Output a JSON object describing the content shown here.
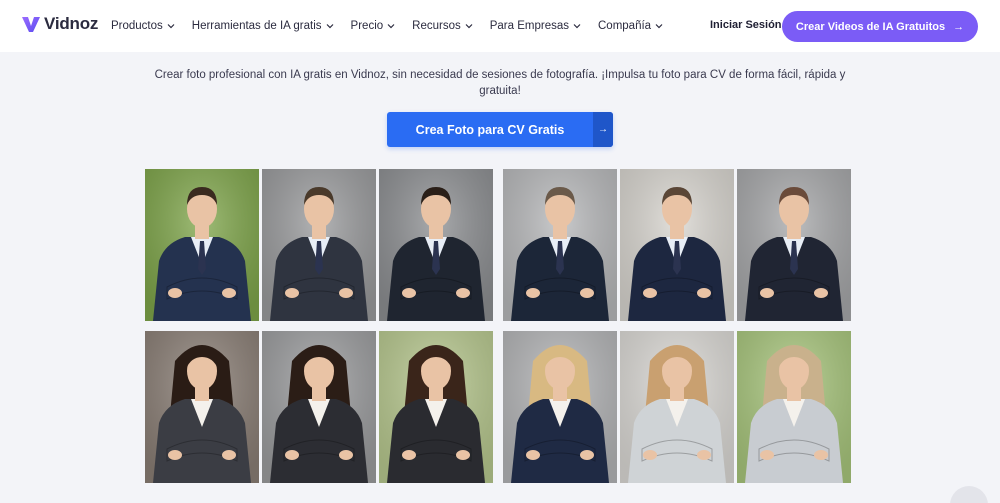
{
  "brand": {
    "name": "Vidnoz",
    "accent": "#7b5cf6",
    "primary_blue": "#2a6cf3"
  },
  "nav": {
    "items": [
      {
        "label": "Productos"
      },
      {
        "label": "Herramientas de IA gratis"
      },
      {
        "label": "Precio"
      },
      {
        "label": "Recursos"
      },
      {
        "label": "Para Empresas"
      },
      {
        "label": "Compañía"
      }
    ],
    "login_label": "Iniciar Sesión",
    "cta_label": "Crear Videos de IA Gratuitos"
  },
  "hero": {
    "subtitle": "Crear foto profesional con IA gratis en Vidnoz, sin necesidad de sesiones de fotografía. ¡Impulsa tu foto para CV de forma fácil, rápida y gratuita!",
    "cta_label": "Crea Foto para CV Gratis",
    "cta_icon": "arrow-right-icon"
  },
  "gallery": {
    "rows": [
      [
        {
          "name": "man-green-bg-crossed-arms",
          "bg": "#7fa64a"
        },
        {
          "name": "man-grey-bg-glasses",
          "bg": "#9a9b9d"
        },
        {
          "name": "man-office-bg-crossed-arms",
          "bg": "#8d8f92"
        },
        {
          "name": "man-grey-bg-smiling",
          "bg": "#b8b9bb"
        },
        {
          "name": "man-office-window-bg",
          "bg": "#d9d6d0"
        },
        {
          "name": "man-grey-bg-closeup",
          "bg": "#a7a8aa"
        }
      ],
      [
        {
          "name": "woman-office-bg-glasses",
          "bg": "#8b7f76"
        },
        {
          "name": "woman-grey-bg-dark-hair",
          "bg": "#9c9d9f"
        },
        {
          "name": "woman-green-bg-crossed-arms",
          "bg": "#b8c98f"
        },
        {
          "name": "woman-grey-bg-blonde",
          "bg": "#b4b5b7"
        },
        {
          "name": "woman-office-bg-glasses-blonde",
          "bg": "#dcdad6"
        },
        {
          "name": "woman-green-bg-blonde",
          "bg": "#a9c77d"
        }
      ]
    ]
  }
}
